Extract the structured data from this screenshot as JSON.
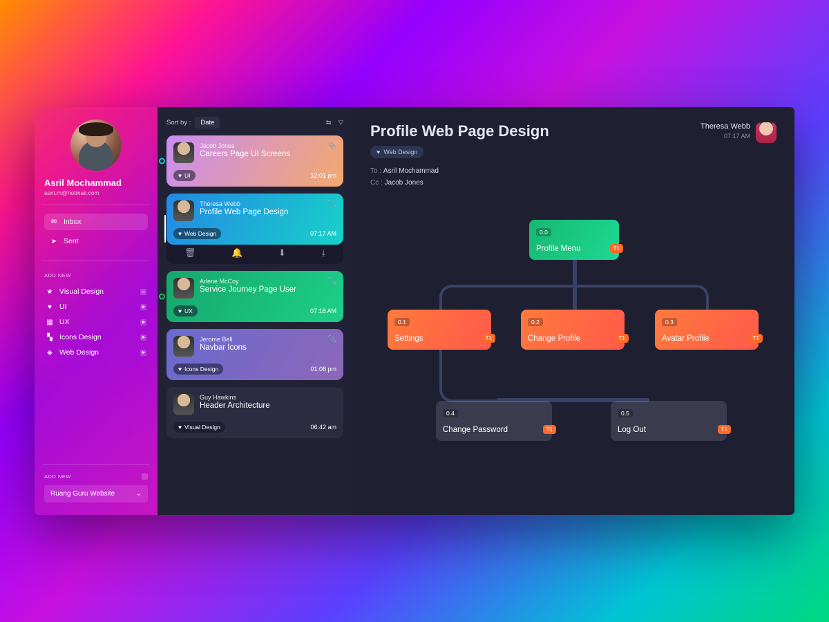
{
  "user": {
    "name": "Asril Mochammad",
    "email": "asril.m@hotmail.com"
  },
  "nav": {
    "inbox": "Inbox",
    "sent": "Sent"
  },
  "section_add_new": "ADD NEW",
  "categories": [
    {
      "label": "Visual Design",
      "icon": "star"
    },
    {
      "label": "UI",
      "icon": "heart"
    },
    {
      "label": "UX",
      "icon": "doc"
    },
    {
      "label": "Icons Design",
      "icon": "grid"
    },
    {
      "label": "Web Design",
      "icon": "square"
    }
  ],
  "project_select": "Ruang Guru Website",
  "sortbar": {
    "label": "Sort by :",
    "value": "Date"
  },
  "messages": [
    {
      "sender": "Jacob Jones",
      "title": "Careers Page UI Screens",
      "tag": "UI",
      "time": "12:01 pm"
    },
    {
      "sender": "Theresa Webb",
      "title": "Profile Web Page Design",
      "tag": "Web Design",
      "time": "07:17 AM"
    },
    {
      "sender": "Arlene McCoy",
      "title": "Service Journey Page User",
      "tag": "UX",
      "time": "07:18 AM"
    },
    {
      "sender": "Jerome Bell",
      "title": "Navbar Icons",
      "tag": "Icons Design",
      "time": "01:08 pm"
    },
    {
      "sender": "Guy Hawkins",
      "title": "Header Architecture",
      "tag": "Visual Design",
      "time": "06:42 am"
    }
  ],
  "detail": {
    "title": "Profile Web Page Design",
    "tag": "Web Design",
    "to_label": "To :",
    "to_value": "Asril Mochammad",
    "cc_label": "Cc :",
    "cc_value": "Jacob Jones",
    "from": "Theresa Webb",
    "time": "07:17 AM"
  },
  "tree": {
    "root": {
      "idx": "0.0",
      "label": "Profile Menu",
      "badge": "T1"
    },
    "mid": [
      {
        "idx": "0.1",
        "label": "Settings",
        "badge": "T1"
      },
      {
        "idx": "0.2",
        "label": "Change Profile",
        "badge": "T1"
      },
      {
        "idx": "0.3",
        "label": "Avatar Profile",
        "badge": "T1"
      }
    ],
    "leaf": [
      {
        "idx": "0.4",
        "label": "Change Password",
        "badge": "T1"
      },
      {
        "idx": "0.5",
        "label": "Log Out",
        "badge": "T1"
      }
    ]
  }
}
